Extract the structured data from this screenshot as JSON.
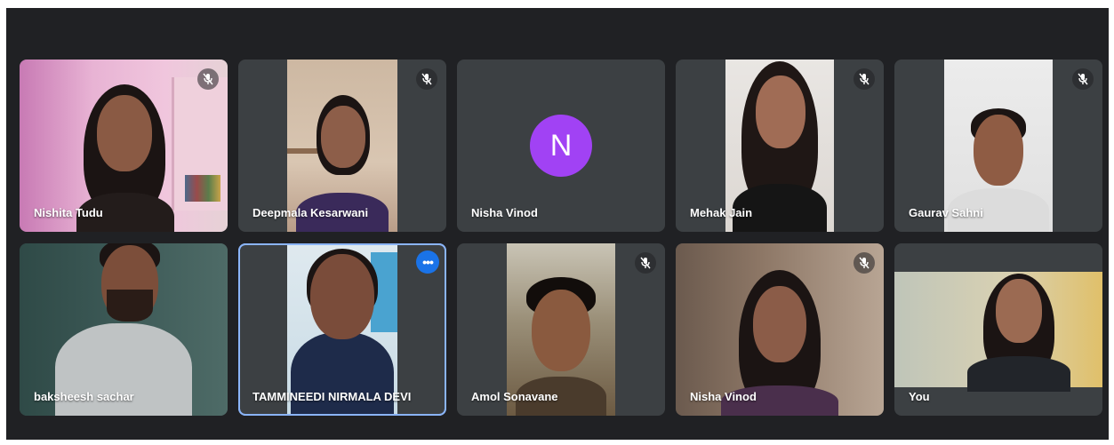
{
  "colors": {
    "stage_bg": "#202124",
    "tile_bg": "#3c4043",
    "active_border": "#8ab4f8",
    "more_button": "#1a73e8",
    "avatar_purple": "#a142f4"
  },
  "participants": [
    {
      "name": "Nishita Tudu",
      "muted": true,
      "icon": "mic-off-icon"
    },
    {
      "name": "Deepmala Kesarwani",
      "muted": true,
      "icon": "mic-off-icon"
    },
    {
      "name": "Nisha Vinod",
      "muted": false,
      "avatar_initial": "N"
    },
    {
      "name": "Mehak Jain",
      "muted": true,
      "icon": "mic-off-icon"
    },
    {
      "name": "Gaurav Sahni",
      "muted": true,
      "icon": "mic-off-icon"
    },
    {
      "name": "baksheesh sachar",
      "muted": false
    },
    {
      "name": "TAMMINEEDI NIRMALA DEVI",
      "muted": false,
      "more_options": "•••",
      "active": true
    },
    {
      "name": "Amol Sonavane",
      "muted": true,
      "icon": "mic-off-icon"
    },
    {
      "name": "Nisha Vinod",
      "muted": true,
      "icon": "mic-off-icon"
    },
    {
      "name": "You",
      "muted": false
    }
  ]
}
